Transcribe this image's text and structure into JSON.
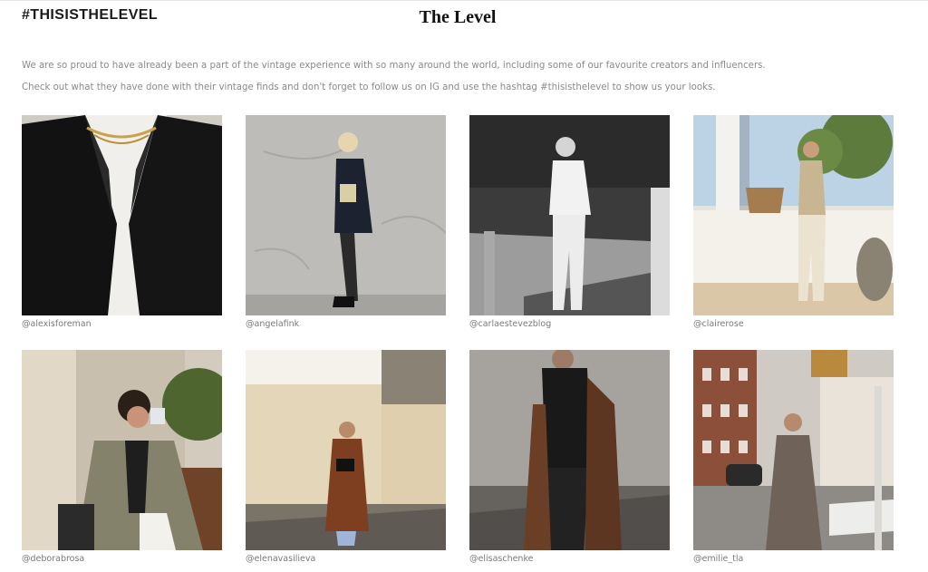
{
  "header": {
    "hashtag": "#THISISTHELEVEL",
    "brand": "The Level"
  },
  "intro": {
    "line1": "We are so proud to have already been a part of the vintage experience with so many around the world, including some of our favourite creators and influencers.",
    "line2": "Check out what they have done with their vintage finds and don't forget to follow us on IG and use the hashtag #thisisthelevel to show us your looks."
  },
  "posts": [
    {
      "handle": "@alexisforeman"
    },
    {
      "handle": "@angelafink"
    },
    {
      "handle": "@carlaestevezblog"
    },
    {
      "handle": "@clairerose"
    },
    {
      "handle": "@deborabrosa"
    },
    {
      "handle": "@elenavasilieva"
    },
    {
      "handle": "@elisaschenke"
    },
    {
      "handle": "@emilie_tla"
    }
  ]
}
